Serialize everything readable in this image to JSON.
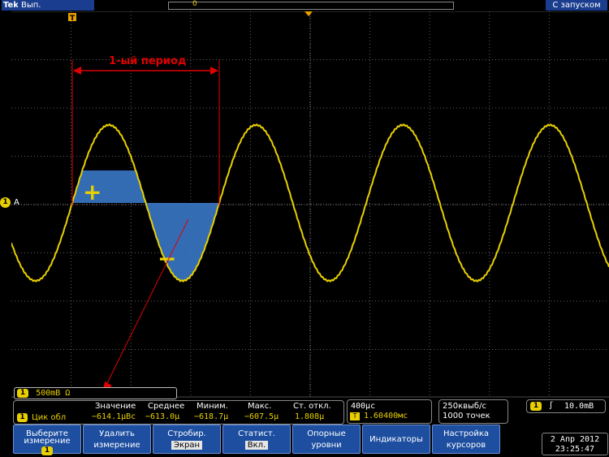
{
  "status": {
    "logo": "Tek",
    "run_state": "Вып.",
    "record_marker": "0",
    "acq_mode": "С запуском"
  },
  "screen": {
    "trigger_marker": "T",
    "channel_marker": "1",
    "ref_marker": "A",
    "annotation_period": "1-ый период",
    "plus_sign": "+",
    "minus_sign": "−"
  },
  "channel": {
    "badge": "1",
    "scale": "500mB Ω"
  },
  "measurement": {
    "badge": "1",
    "name": "Цик обл",
    "headers": [
      "Значение",
      "Среднее",
      "Миним.",
      "Макс.",
      "Ст. откл."
    ],
    "values": [
      "−614.1µBc",
      "−613.0µ",
      "−618.7µ",
      "−607.5µ",
      "1.808µ"
    ]
  },
  "horizontal": {
    "scale": "400µс",
    "delay": "1.60400мс",
    "delay_icon": "T"
  },
  "acquisition": {
    "rate": "250квыб/с",
    "points": "1000 точек"
  },
  "trigger": {
    "badge": "1",
    "slope": "ʃ",
    "level": "10.0mB"
  },
  "softkeys": [
    {
      "l1": "Выберите",
      "l2": "измерение",
      "chip": "1"
    },
    {
      "l1": "Удалить",
      "l2": "измерение"
    },
    {
      "l1": "Стробир.",
      "l2": "Экран"
    },
    {
      "l1": "Статист.",
      "l2": "Вкл."
    },
    {
      "l1": "Опорные",
      "l2": "уровни"
    },
    {
      "l1": "Индикаторы",
      "l2": ""
    },
    {
      "l1": "Настройка",
      "l2": "курсоров"
    }
  ],
  "datetime": {
    "date": "2 Апр 2012",
    "time": "23:25:47"
  },
  "waveform": {
    "color": "#e8d000",
    "fill_color": "#3a78c8",
    "annotation_color": "#e00000"
  }
}
